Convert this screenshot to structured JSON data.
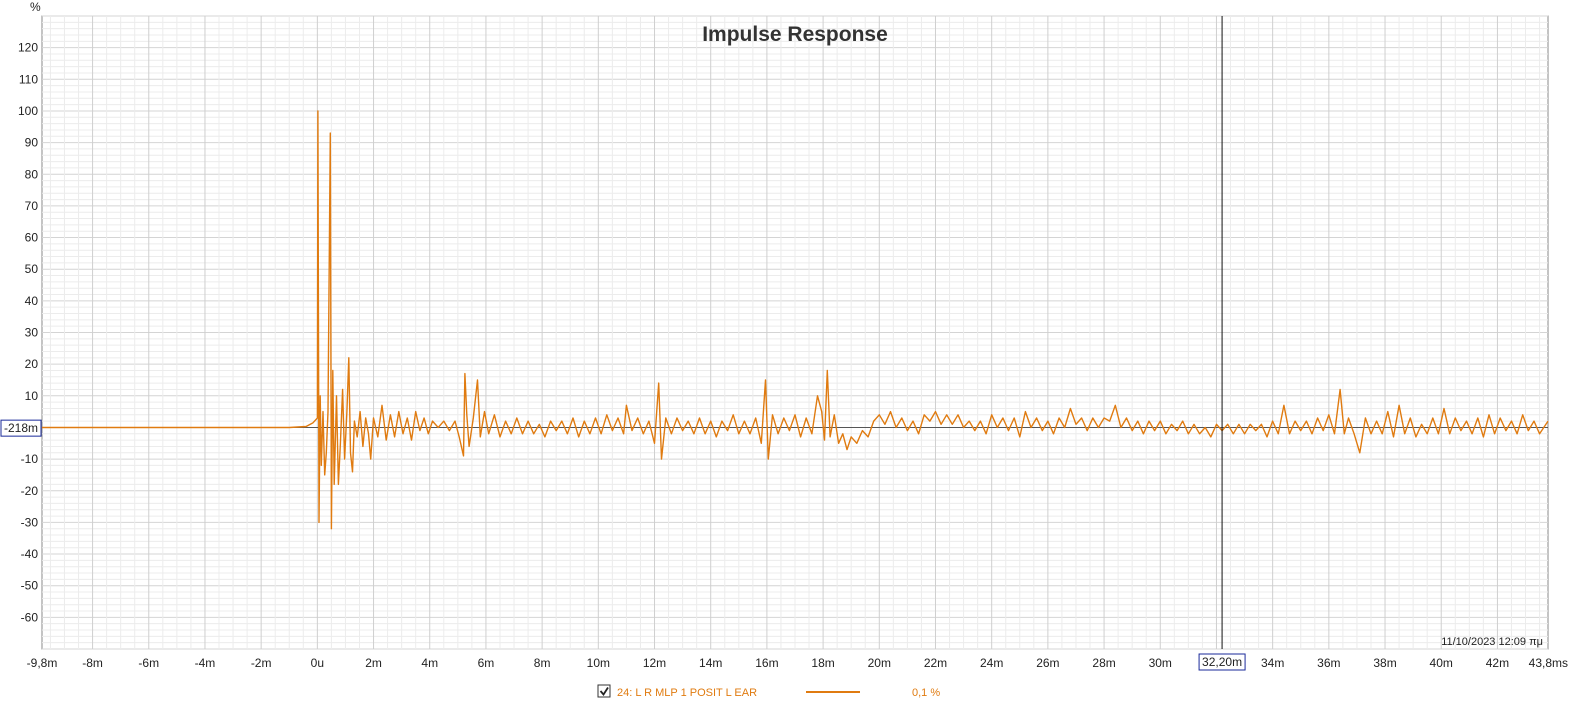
{
  "chart_data": {
    "type": "line",
    "title": "Impulse Response",
    "y_unit": "%",
    "x_unit": "ms",
    "xlim_ms": [
      -9.8,
      43.8
    ],
    "ylim": [
      -70,
      130
    ],
    "grid": true,
    "y_ticks": [
      {
        "value": 120,
        "label": "120"
      },
      {
        "value": 110,
        "label": "110"
      },
      {
        "value": 100,
        "label": "100"
      },
      {
        "value": 90,
        "label": "90"
      },
      {
        "value": 80,
        "label": "80"
      },
      {
        "value": 70,
        "label": "70"
      },
      {
        "value": 60,
        "label": "60"
      },
      {
        "value": 50,
        "label": "50"
      },
      {
        "value": 40,
        "label": "40"
      },
      {
        "value": 30,
        "label": "30"
      },
      {
        "value": 20,
        "label": "20"
      },
      {
        "value": 10,
        "label": "10"
      },
      {
        "value": -10,
        "label": "-10"
      },
      {
        "value": -20,
        "label": "-20"
      },
      {
        "value": -30,
        "label": "-30"
      },
      {
        "value": -40,
        "label": "-40"
      },
      {
        "value": -50,
        "label": "-50"
      },
      {
        "value": -60,
        "label": "-60"
      }
    ],
    "x_ticks": [
      {
        "value": -9.8,
        "label": "-9,8m"
      },
      {
        "value": -8,
        "label": "-8m"
      },
      {
        "value": -6,
        "label": "-6m"
      },
      {
        "value": -4,
        "label": "-4m"
      },
      {
        "value": -2,
        "label": "-2m"
      },
      {
        "value": 0,
        "label": "0u"
      },
      {
        "value": 2,
        "label": "2m"
      },
      {
        "value": 4,
        "label": "4m"
      },
      {
        "value": 6,
        "label": "6m"
      },
      {
        "value": 8,
        "label": "8m"
      },
      {
        "value": 10,
        "label": "10m"
      },
      {
        "value": 12,
        "label": "12m"
      },
      {
        "value": 14,
        "label": "14m"
      },
      {
        "value": 16,
        "label": "16m"
      },
      {
        "value": 18,
        "label": "18m"
      },
      {
        "value": 20,
        "label": "20m"
      },
      {
        "value": 22,
        "label": "22m"
      },
      {
        "value": 24,
        "label": "24m"
      },
      {
        "value": 26,
        "label": "26m"
      },
      {
        "value": 28,
        "label": "28m"
      },
      {
        "value": 30,
        "label": "30m"
      },
      {
        "value": 34,
        "label": "34m"
      },
      {
        "value": 36,
        "label": "36m"
      },
      {
        "value": 38,
        "label": "38m"
      },
      {
        "value": 40,
        "label": "40m"
      },
      {
        "value": 42,
        "label": "42m"
      },
      {
        "value": 43.8,
        "label": "43,8ms"
      }
    ],
    "cursor": {
      "x_ms": 32.2,
      "x_label": "32,20m",
      "y_label": "-218m",
      "y_value": -0.218
    },
    "timestamp": "11/10/2023 12:09 πμ",
    "series": [
      {
        "name": "24: L R MLP 1 POSIT L EAR",
        "color": "#e07b10",
        "smoothing": "0,1 %",
        "points": [
          [
            -9.8,
            0
          ],
          [
            -1.0,
            0
          ],
          [
            -0.4,
            0.3
          ],
          [
            -0.15,
            1.5
          ],
          [
            0.0,
            3
          ],
          [
            0.02,
            100
          ],
          [
            0.06,
            -30
          ],
          [
            0.1,
            10
          ],
          [
            0.14,
            -12
          ],
          [
            0.2,
            5
          ],
          [
            0.26,
            -15
          ],
          [
            0.32,
            -8
          ],
          [
            0.38,
            5
          ],
          [
            0.46,
            93
          ],
          [
            0.5,
            -32
          ],
          [
            0.55,
            18
          ],
          [
            0.6,
            -18
          ],
          [
            0.68,
            10
          ],
          [
            0.75,
            -18
          ],
          [
            0.82,
            -5
          ],
          [
            0.9,
            12
          ],
          [
            0.97,
            -10
          ],
          [
            1.05,
            5
          ],
          [
            1.12,
            22
          ],
          [
            1.18,
            -8
          ],
          [
            1.25,
            -14
          ],
          [
            1.32,
            2
          ],
          [
            1.42,
            -3
          ],
          [
            1.52,
            5
          ],
          [
            1.62,
            -6
          ],
          [
            1.72,
            3
          ],
          [
            1.82,
            -2
          ],
          [
            1.9,
            -10
          ],
          [
            2.0,
            3
          ],
          [
            2.15,
            -3
          ],
          [
            2.3,
            7
          ],
          [
            2.45,
            -4
          ],
          [
            2.6,
            4
          ],
          [
            2.75,
            -3
          ],
          [
            2.9,
            5
          ],
          [
            3.05,
            -2
          ],
          [
            3.2,
            3
          ],
          [
            3.35,
            -4
          ],
          [
            3.5,
            5
          ],
          [
            3.65,
            -1
          ],
          [
            3.8,
            3
          ],
          [
            3.95,
            -2
          ],
          [
            4.1,
            2
          ],
          [
            4.3,
            0
          ],
          [
            4.5,
            2
          ],
          [
            4.7,
            -1
          ],
          [
            4.9,
            2
          ],
          [
            5.05,
            -3
          ],
          [
            5.2,
            -9
          ],
          [
            5.25,
            17
          ],
          [
            5.32,
            4
          ],
          [
            5.4,
            -6
          ],
          [
            5.55,
            3
          ],
          [
            5.7,
            15
          ],
          [
            5.8,
            -3
          ],
          [
            5.95,
            5
          ],
          [
            6.1,
            -2
          ],
          [
            6.3,
            4
          ],
          [
            6.5,
            -3
          ],
          [
            6.7,
            2
          ],
          [
            6.9,
            -2
          ],
          [
            7.1,
            3
          ],
          [
            7.3,
            -2
          ],
          [
            7.5,
            2
          ],
          [
            7.7,
            -2
          ],
          [
            7.9,
            1
          ],
          [
            8.1,
            -3
          ],
          [
            8.3,
            2
          ],
          [
            8.5,
            -1
          ],
          [
            8.7,
            2
          ],
          [
            8.9,
            -2
          ],
          [
            9.1,
            3
          ],
          [
            9.3,
            -3
          ],
          [
            9.5,
            2
          ],
          [
            9.7,
            -2
          ],
          [
            9.9,
            3
          ],
          [
            10.1,
            -2
          ],
          [
            10.3,
            4
          ],
          [
            10.5,
            -1
          ],
          [
            10.7,
            3
          ],
          [
            10.9,
            -2
          ],
          [
            11.0,
            7
          ],
          [
            11.2,
            -1
          ],
          [
            11.4,
            3
          ],
          [
            11.6,
            -2
          ],
          [
            11.8,
            2
          ],
          [
            12.0,
            -5
          ],
          [
            12.15,
            14
          ],
          [
            12.25,
            -10
          ],
          [
            12.4,
            3
          ],
          [
            12.6,
            -2
          ],
          [
            12.8,
            3
          ],
          [
            13.0,
            -1
          ],
          [
            13.2,
            2
          ],
          [
            13.4,
            -2
          ],
          [
            13.6,
            3
          ],
          [
            13.8,
            -2
          ],
          [
            14.0,
            2
          ],
          [
            14.2,
            -3
          ],
          [
            14.4,
            2
          ],
          [
            14.6,
            -1
          ],
          [
            14.8,
            4
          ],
          [
            15.0,
            -2
          ],
          [
            15.2,
            2
          ],
          [
            15.4,
            -2
          ],
          [
            15.6,
            3
          ],
          [
            15.8,
            -5
          ],
          [
            15.95,
            15
          ],
          [
            16.05,
            -10
          ],
          [
            16.2,
            4
          ],
          [
            16.4,
            -2
          ],
          [
            16.6,
            3
          ],
          [
            16.8,
            -1
          ],
          [
            17.0,
            4
          ],
          [
            17.2,
            -3
          ],
          [
            17.4,
            3
          ],
          [
            17.6,
            -2
          ],
          [
            17.8,
            10
          ],
          [
            17.95,
            5
          ],
          [
            18.05,
            -4
          ],
          [
            18.15,
            18
          ],
          [
            18.25,
            -3
          ],
          [
            18.4,
            4
          ],
          [
            18.55,
            -5
          ],
          [
            18.7,
            -2
          ],
          [
            18.85,
            -7
          ],
          [
            19.0,
            -3
          ],
          [
            19.2,
            -5
          ],
          [
            19.4,
            -1
          ],
          [
            19.6,
            -3
          ],
          [
            19.8,
            2
          ],
          [
            20.0,
            4
          ],
          [
            20.2,
            1
          ],
          [
            20.4,
            5
          ],
          [
            20.6,
            0
          ],
          [
            20.8,
            3
          ],
          [
            21.0,
            -1
          ],
          [
            21.2,
            2
          ],
          [
            21.4,
            -2
          ],
          [
            21.6,
            4
          ],
          [
            21.8,
            2
          ],
          [
            22.0,
            5
          ],
          [
            22.2,
            1
          ],
          [
            22.4,
            4
          ],
          [
            22.6,
            1
          ],
          [
            22.8,
            4
          ],
          [
            23.0,
            0
          ],
          [
            23.2,
            2
          ],
          [
            23.4,
            -1
          ],
          [
            23.6,
            2
          ],
          [
            23.8,
            -2
          ],
          [
            24.0,
            4
          ],
          [
            24.2,
            0
          ],
          [
            24.4,
            3
          ],
          [
            24.6,
            -1
          ],
          [
            24.8,
            3
          ],
          [
            25.0,
            -3
          ],
          [
            25.2,
            5
          ],
          [
            25.4,
            0
          ],
          [
            25.6,
            3
          ],
          [
            25.8,
            -1
          ],
          [
            26.0,
            2
          ],
          [
            26.2,
            -2
          ],
          [
            26.4,
            3
          ],
          [
            26.6,
            0
          ],
          [
            26.8,
            6
          ],
          [
            27.0,
            1
          ],
          [
            27.2,
            3
          ],
          [
            27.4,
            -1
          ],
          [
            27.6,
            3
          ],
          [
            27.8,
            0
          ],
          [
            28.0,
            3
          ],
          [
            28.2,
            2
          ],
          [
            28.4,
            7
          ],
          [
            28.6,
            0
          ],
          [
            28.8,
            3
          ],
          [
            29.0,
            -1
          ],
          [
            29.2,
            2
          ],
          [
            29.4,
            -2
          ],
          [
            29.6,
            2
          ],
          [
            29.8,
            -1
          ],
          [
            30.0,
            2
          ],
          [
            30.2,
            -2
          ],
          [
            30.4,
            1
          ],
          [
            30.6,
            -1
          ],
          [
            30.8,
            2
          ],
          [
            31.0,
            -2
          ],
          [
            31.2,
            1
          ],
          [
            31.4,
            -2
          ],
          [
            31.6,
            0
          ],
          [
            31.8,
            -3
          ],
          [
            32.0,
            1
          ],
          [
            32.2,
            -1
          ],
          [
            32.4,
            1
          ],
          [
            32.6,
            -2
          ],
          [
            32.8,
            1
          ],
          [
            33.0,
            -2
          ],
          [
            33.2,
            1
          ],
          [
            33.4,
            -1
          ],
          [
            33.6,
            1
          ],
          [
            33.8,
            -3
          ],
          [
            34.0,
            2
          ],
          [
            34.2,
            -2
          ],
          [
            34.4,
            7
          ],
          [
            34.6,
            -2
          ],
          [
            34.8,
            2
          ],
          [
            35.0,
            -1
          ],
          [
            35.2,
            2
          ],
          [
            35.4,
            -2
          ],
          [
            35.6,
            3
          ],
          [
            35.8,
            -1
          ],
          [
            36.0,
            4
          ],
          [
            36.2,
            -2
          ],
          [
            36.4,
            12
          ],
          [
            36.55,
            -2
          ],
          [
            36.7,
            3
          ],
          [
            36.9,
            -2
          ],
          [
            37.1,
            -8
          ],
          [
            37.3,
            3
          ],
          [
            37.5,
            -2
          ],
          [
            37.7,
            2
          ],
          [
            37.9,
            -2
          ],
          [
            38.1,
            5
          ],
          [
            38.3,
            -3
          ],
          [
            38.5,
            7
          ],
          [
            38.7,
            -2
          ],
          [
            38.9,
            3
          ],
          [
            39.1,
            -3
          ],
          [
            39.3,
            1
          ],
          [
            39.5,
            -2
          ],
          [
            39.7,
            3
          ],
          [
            39.9,
            -2
          ],
          [
            40.1,
            6
          ],
          [
            40.3,
            -2
          ],
          [
            40.5,
            3
          ],
          [
            40.7,
            -1
          ],
          [
            40.9,
            2
          ],
          [
            41.1,
            -2
          ],
          [
            41.3,
            3
          ],
          [
            41.5,
            -3
          ],
          [
            41.7,
            4
          ],
          [
            41.9,
            -2
          ],
          [
            42.1,
            3
          ],
          [
            42.3,
            -1
          ],
          [
            42.5,
            2
          ],
          [
            42.7,
            -2
          ],
          [
            42.9,
            4
          ],
          [
            43.1,
            -1
          ],
          [
            43.3,
            2
          ],
          [
            43.5,
            -2
          ],
          [
            43.8,
            2
          ]
        ]
      }
    ]
  },
  "legend": {
    "checkbox_checked": true,
    "series_label": "24: L R MLP 1 POSIT L EAR",
    "smoothing_label": "0,1 %"
  }
}
